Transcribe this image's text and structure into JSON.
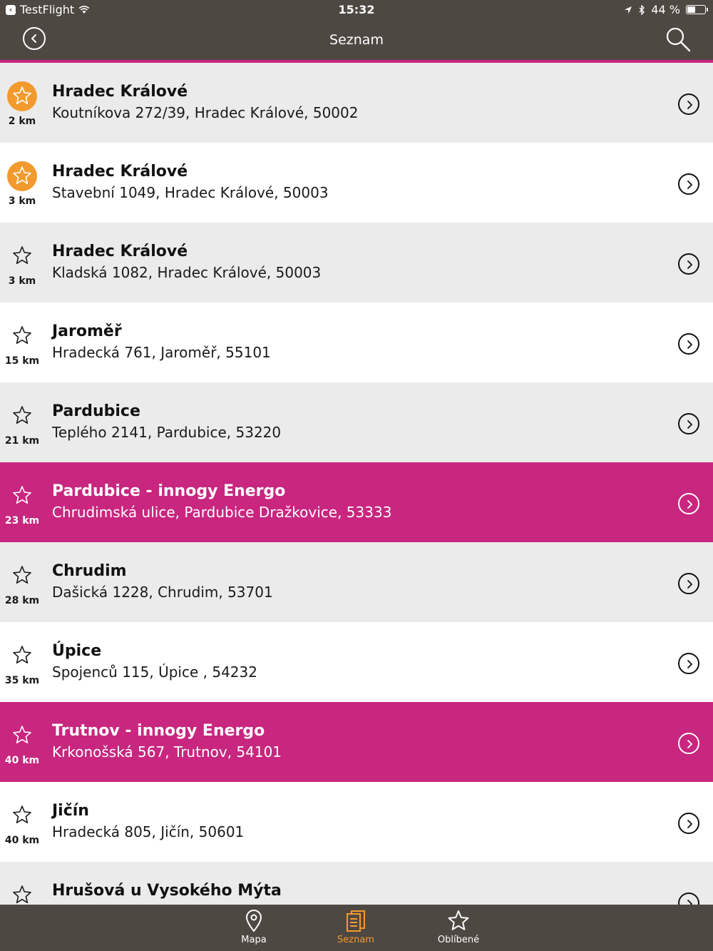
{
  "status_bar": {
    "app_back": "TestFlight",
    "time": "15:32",
    "battery": "44 %"
  },
  "nav": {
    "title": "Seznam"
  },
  "list": [
    {
      "name": "Hradec Králové",
      "address": "Koutníkova 272/39, Hradec Králové, 50002",
      "distance": "2 km",
      "favorite": true,
      "highlight": false
    },
    {
      "name": "Hradec Králové",
      "address": "Stavební 1049, Hradec Králové, 50003",
      "distance": "3 km",
      "favorite": true,
      "highlight": false
    },
    {
      "name": "Hradec Králové",
      "address": "Kladská 1082, Hradec Králové, 50003",
      "distance": "3 km",
      "favorite": false,
      "highlight": false
    },
    {
      "name": "Jaroměř",
      "address": "Hradecká 761, Jaroměř, 55101",
      "distance": "15 km",
      "favorite": false,
      "highlight": false
    },
    {
      "name": "Pardubice",
      "address": "Teplého 2141, Pardubice, 53220",
      "distance": "21 km",
      "favorite": false,
      "highlight": false
    },
    {
      "name": "Pardubice - innogy Energo",
      "address": "Chrudimská ulice, Pardubice Dražkovice, 53333",
      "distance": "23 km",
      "favorite": false,
      "highlight": true
    },
    {
      "name": "Chrudim",
      "address": "Dašická 1228, Chrudim, 53701",
      "distance": "28 km",
      "favorite": false,
      "highlight": false
    },
    {
      "name": "Úpice",
      "address": "Spojenců 115, Úpice , 54232",
      "distance": "35 km",
      "favorite": false,
      "highlight": false
    },
    {
      "name": "Trutnov - innogy Energo",
      "address": "Krkonošská 567, Trutnov, 54101",
      "distance": "40 km",
      "favorite": false,
      "highlight": true
    },
    {
      "name": "Jičín",
      "address": "Hradecká 805, Jičín, 50601",
      "distance": "40 km",
      "favorite": false,
      "highlight": false
    },
    {
      "name": "Hrušová u Vysokého Mýta",
      "address": "",
      "distance": "",
      "favorite": false,
      "highlight": false
    }
  ],
  "tabs": {
    "map": "Mapa",
    "list": "Seznam",
    "favorites": "Oblíbené"
  },
  "colors": {
    "bar": "#4e4843",
    "accent": "#c8267f",
    "favorite": "#f29a2e",
    "row_alt": "#ebebeb"
  }
}
